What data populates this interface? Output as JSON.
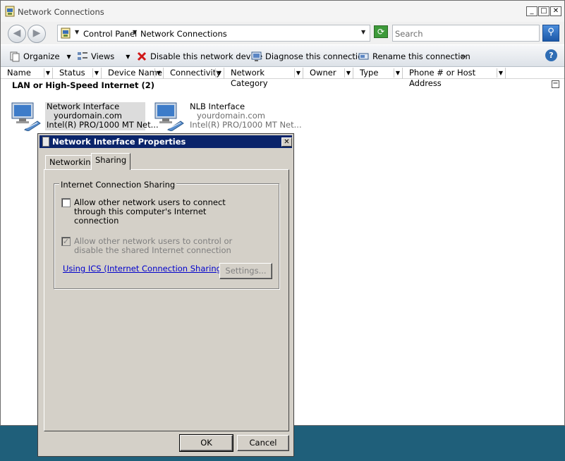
{
  "window": {
    "title": "Network Connections",
    "controls": {
      "minimize": "_",
      "maximize": "□",
      "close": "✕"
    }
  },
  "nav": {
    "back_glyph": "◀",
    "forward_glyph": "▶",
    "breadcrumb": [
      "Control Panel",
      "Network Connections"
    ],
    "refresh_glyph": "⟳",
    "search_placeholder": "Search",
    "search_glyph": "⚲"
  },
  "toolbar": {
    "organize": "Organize",
    "views": "Views",
    "disable": "Disable this network device",
    "diagnose": "Diagnose this connection",
    "rename": "Rename this connection",
    "more": "»",
    "help": "?"
  },
  "columns": [
    "Name",
    "Status",
    "Device Name",
    "Connectivity",
    "Network Category",
    "Owner",
    "Type",
    "Phone # or Host Address"
  ],
  "group": {
    "title": "LAN or High-Speed Internet (2)",
    "collapse_glyph": "−"
  },
  "items": [
    {
      "name": "Network Interface",
      "domain": "yourdomain.com",
      "device": "Intel(R) PRO/1000 MT Net..."
    },
    {
      "name": "NLB Interface",
      "domain": "yourdomain.com",
      "device": "Intel(R) PRO/1000 MT Net..."
    }
  ],
  "dialog": {
    "title": "Network Interface Properties",
    "close_glyph": "✕",
    "tabs": [
      "Networking",
      "Sharing"
    ],
    "group_label": "Internet Connection Sharing",
    "option1": "Allow other network users to connect through this computer's Internet connection",
    "option2": "Allow other network users to control or disable the shared Internet connection",
    "check_glyph": "✓",
    "link": "Using ICS (Internet Connection Sharing)",
    "settings": "Settings...",
    "ok": "OK",
    "cancel": "Cancel"
  },
  "colors": {
    "dialog_title": "#0a246a",
    "dialog_face": "#d4d0c8",
    "link": "#0000cc",
    "desktop": "#1f5f7a"
  }
}
